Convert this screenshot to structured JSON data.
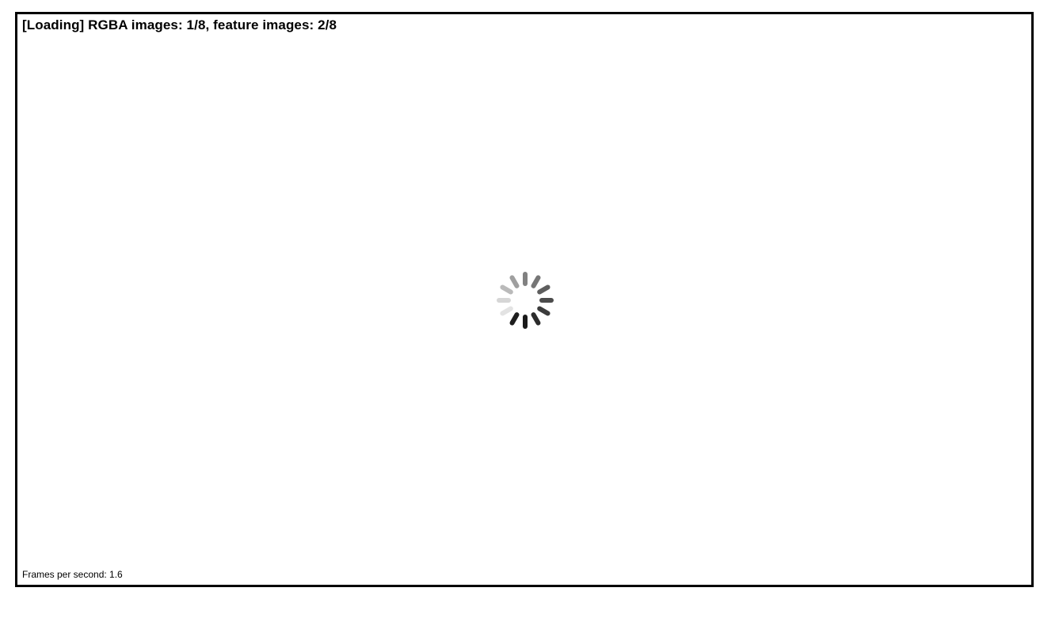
{
  "viewer": {
    "status_text": "[Loading] RGBA images: 1/8, feature images: 2/8",
    "fps_text": "Frames per second: 1.6"
  },
  "spinner": {
    "icon": "loading-spinner-icon",
    "color": "#1a1a1a",
    "segments": 12
  }
}
